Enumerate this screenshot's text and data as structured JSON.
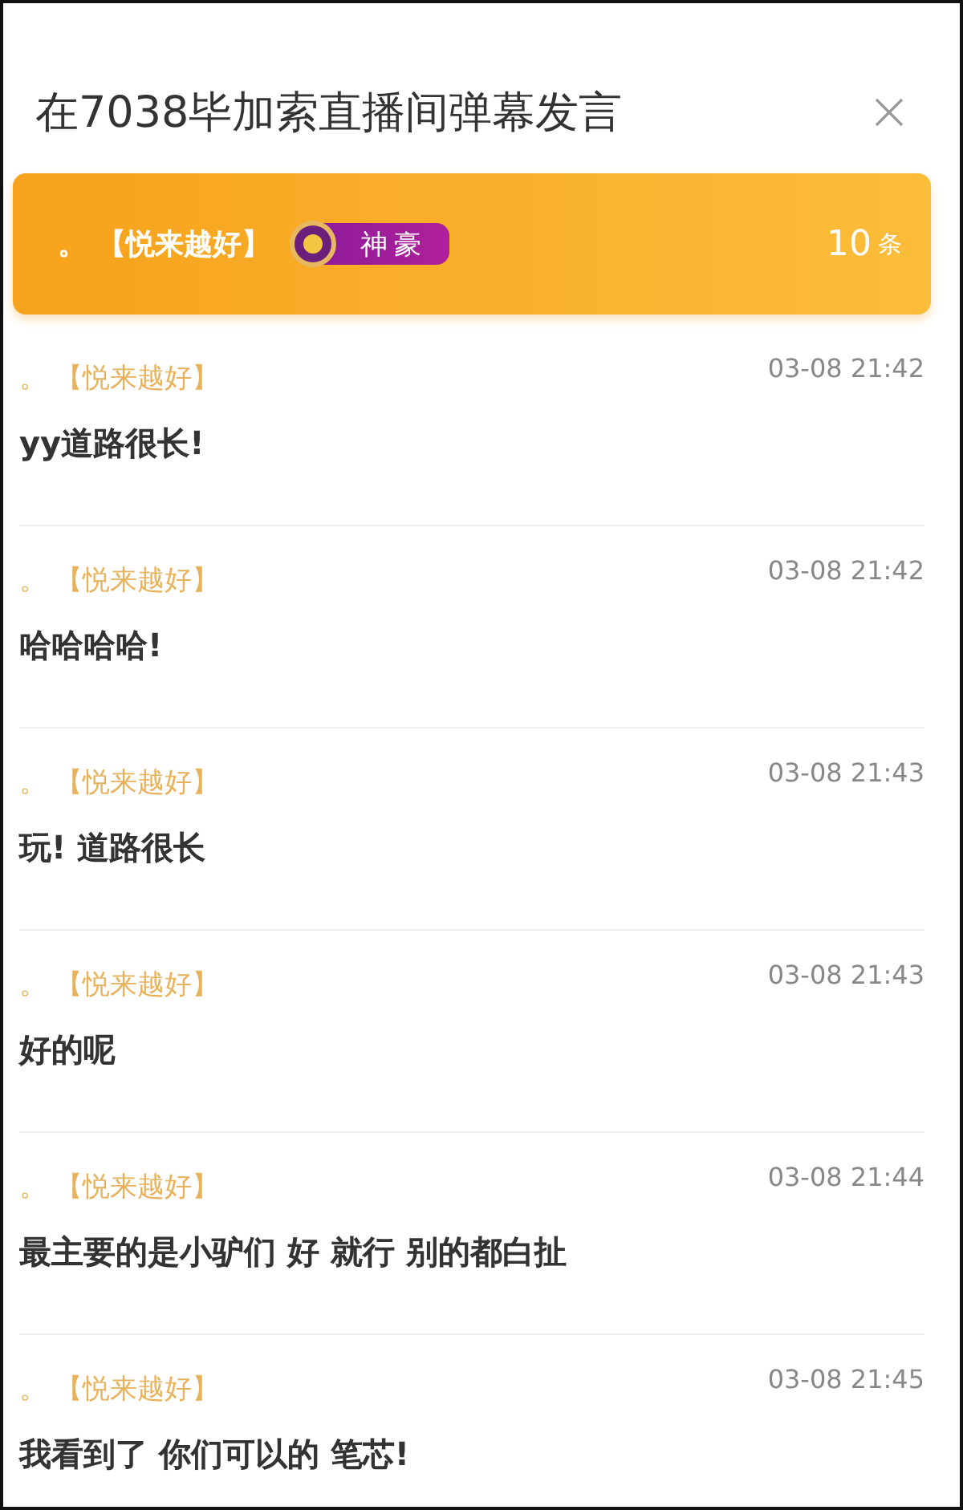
{
  "title": "在7038毕加索直播间弹幕发言",
  "header": {
    "user": "。 【悦来越好】",
    "badge": "神豪",
    "count": "10",
    "count_unit": "条"
  },
  "messages": [
    {
      "user": "。 【悦来越好】",
      "time": "03-08 21:42",
      "text": "yy道路很长!"
    },
    {
      "user": "。 【悦来越好】",
      "time": "03-08 21:42",
      "text": "哈哈哈哈!"
    },
    {
      "user": "。 【悦来越好】",
      "time": "03-08 21:43",
      "text": "玩! 道路很长"
    },
    {
      "user": "。 【悦来越好】",
      "time": "03-08 21:43",
      "text": "好的呢"
    },
    {
      "user": "。 【悦来越好】",
      "time": "03-08 21:44",
      "text": "最主要的是小驴们 好 就行 别的都白扯"
    },
    {
      "user": "。 【悦来越好】",
      "time": "03-08 21:45",
      "text": "我看到了 你们可以的 笔芯!"
    }
  ]
}
